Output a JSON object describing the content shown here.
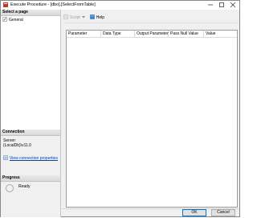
{
  "window": {
    "title": "Execute Procedure - [dbo].[SelectFromTable]"
  },
  "left_pane": {
    "select_page_header": "Select a page",
    "pages": [
      {
        "label": "General",
        "icon": "wrench-page-icon"
      }
    ],
    "connection": {
      "header": "Connection",
      "server_label": "Server:",
      "server_value": "(LocalDb)\\v11.0",
      "view_link": "View connection properties"
    },
    "progress": {
      "header": "Progress",
      "status": "Ready"
    }
  },
  "toolbar": {
    "script_label": "Script",
    "help_label": "Help"
  },
  "grid": {
    "columns": [
      "Parameter",
      "Data Type",
      "Output Parameter",
      "Pass Null Value",
      "Value"
    ]
  },
  "buttons": {
    "ok": "OK",
    "cancel": "Cancel"
  },
  "colors": {
    "link": "#0645ad",
    "focus_border": "#0078d7"
  }
}
